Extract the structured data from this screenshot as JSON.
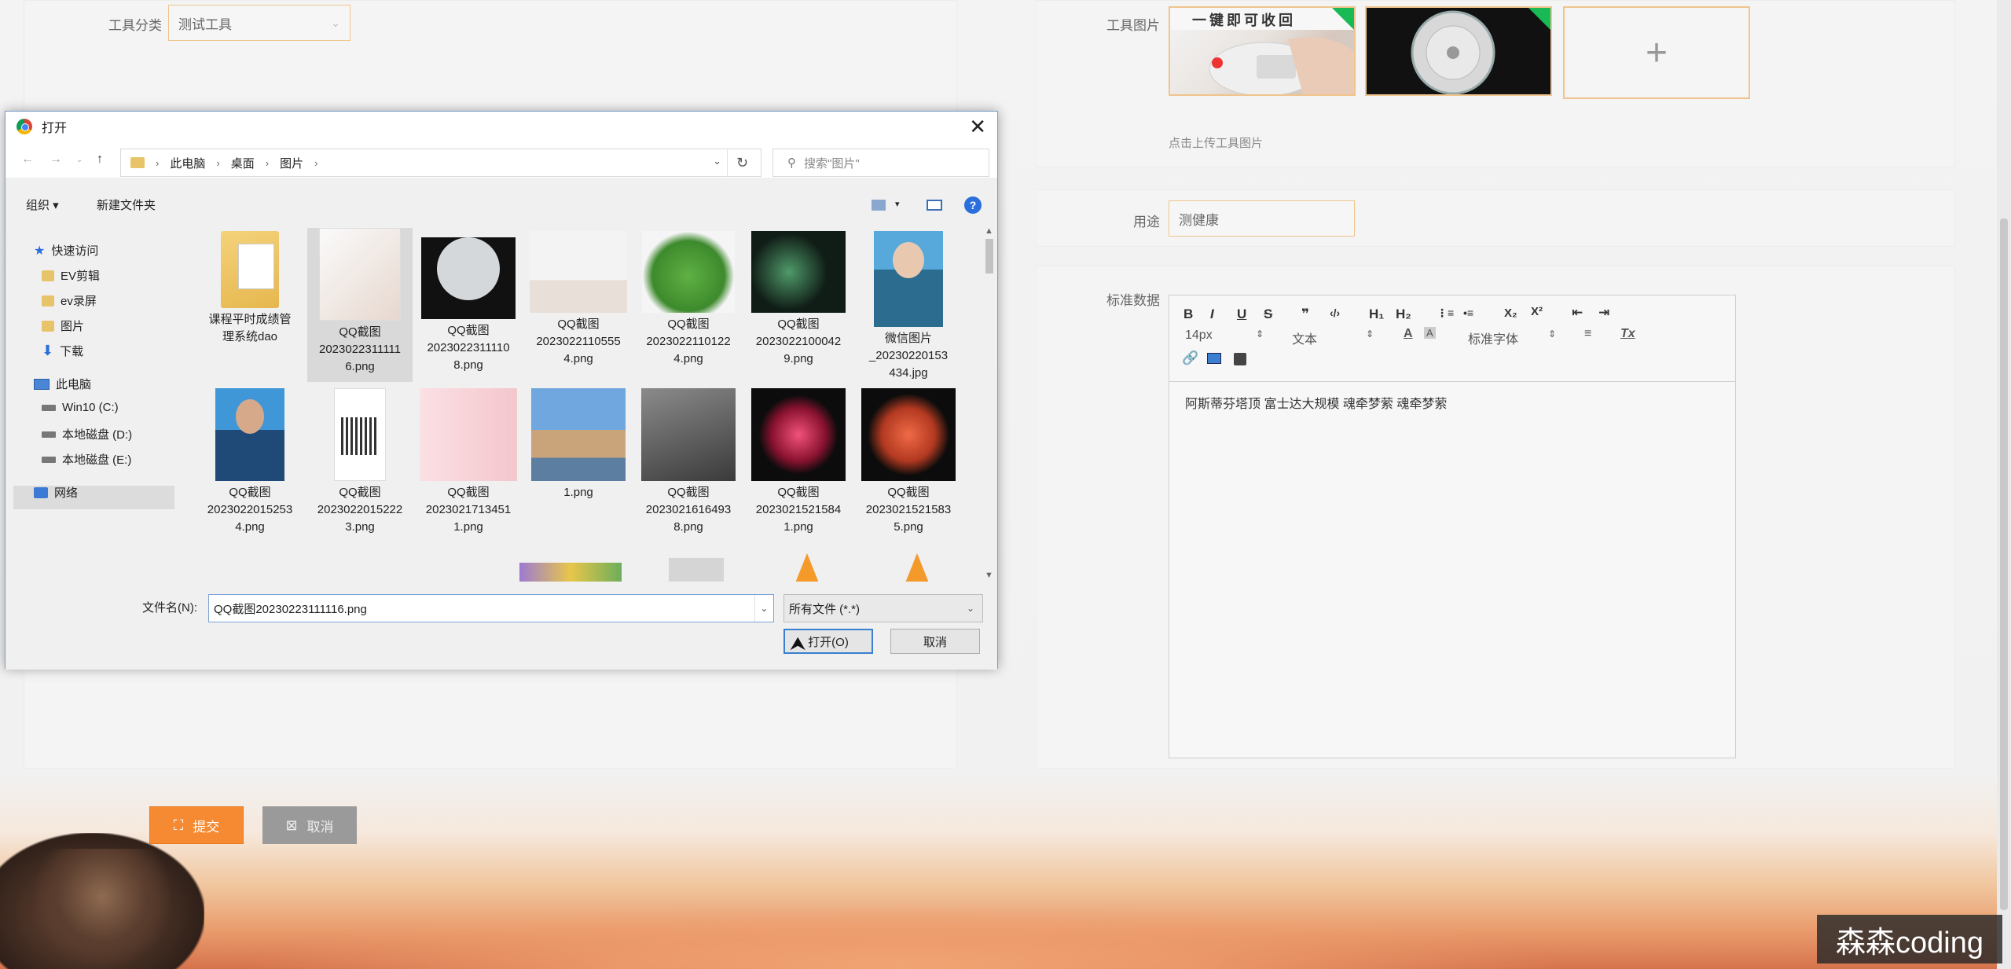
{
  "form": {
    "category_label": "工具分类",
    "category_value": "测试工具",
    "image_label": "工具图片",
    "upload_hint": "点击上传工具图片",
    "thumb1_text": "一键即可收回",
    "add_symbol": "+",
    "purpose_label": "用途",
    "purpose_value": "测健康",
    "std_label": "标准数据",
    "editor_content": "阿斯蒂芬塔顶 富士达大规模 魂牵梦萦 魂牵梦萦",
    "submit_label": "提交",
    "cancel_label": "取消"
  },
  "editor_toolbar": {
    "bold": "B",
    "italic": "I",
    "underline": "U",
    "strike": "S",
    "quote": "❞",
    "code": "‹/›",
    "h1": "H₁",
    "h2": "H₂",
    "ol": "⋮≡",
    "ul": "•≡",
    "sub": "X₂",
    "sup": "X²",
    "outdent": "⇤",
    "indent": "⇥",
    "size": "14px",
    "block": "文本",
    "font": "标准字体",
    "align": "≡",
    "clear": "Tx"
  },
  "dialog": {
    "title": "打开",
    "close": "✕",
    "breadcrumb": [
      "此电脑",
      "桌面",
      "图片"
    ],
    "search_placeholder": "搜索\"图片\"",
    "organize": "组织 ▾",
    "new_folder": "新建文件夹",
    "help": "?",
    "nav": {
      "quick_access": "快速访问",
      "items": [
        "EV剪辑",
        "ev录屏",
        "图片",
        "下载"
      ],
      "this_pc": "此电脑",
      "drives": [
        "Win10 (C:)",
        "本地磁盘 (D:)",
        "本地磁盘 (E:)"
      ],
      "network": "网络"
    },
    "files": [
      {
        "name": "课程平时成绩管理系统dao"
      },
      {
        "name": "QQ截图20230223111116.png"
      },
      {
        "name": "QQ截图20230223111108.png"
      },
      {
        "name": "QQ截图20230221105554.png"
      },
      {
        "name": "QQ截图20230221101224.png"
      },
      {
        "name": "QQ截图20230221000429.png"
      },
      {
        "name": "微信图片_20230220153434.jpg"
      },
      {
        "name": "QQ截图20230220152534.png"
      },
      {
        "name": "QQ截图20230220152223.png"
      },
      {
        "name": "QQ截图20230217134511.png"
      },
      {
        "name": "1.png"
      },
      {
        "name": "QQ截图20230216164938.png"
      },
      {
        "name": "QQ截图20230215215841.png"
      },
      {
        "name": "QQ截图20230215215835.png"
      }
    ],
    "filename_label": "文件名(N):",
    "filename_value": "QQ截图20230223111116.png",
    "filetype": "所有文件 (*.*)",
    "open_label": "打开(O)",
    "cancel_label": "取消"
  },
  "watermark": "森森coding"
}
